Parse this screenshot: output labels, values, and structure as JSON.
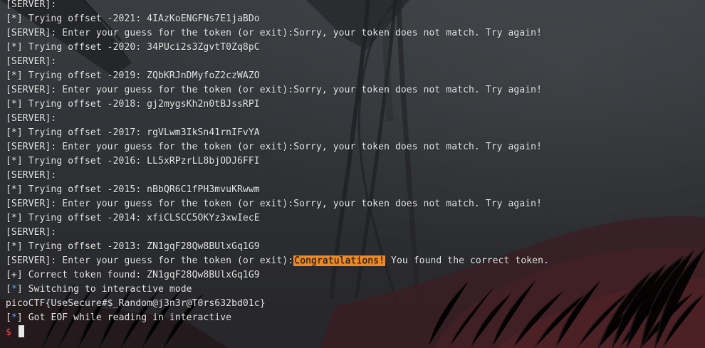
{
  "terminal": {
    "lines": [
      {
        "type": "plain",
        "text": "[SERVER]:"
      },
      {
        "type": "plain",
        "text": "[*] Trying offset -2021: 4IAzKoENGFNs7E1jaBDo"
      },
      {
        "type": "plain",
        "text": "[SERVER]: Enter your guess for the token (or exit):Sorry, your token does not match. Try again!"
      },
      {
        "type": "plain",
        "text": "[*] Trying offset -2020: 34PUci2s3ZgvtT0Zq8pC"
      },
      {
        "type": "plain",
        "text": "[SERVER]:"
      },
      {
        "type": "plain",
        "text": "[*] Trying offset -2019: ZQbKRJnDMyfoZ2czWAZO"
      },
      {
        "type": "plain",
        "text": "[SERVER]: Enter your guess for the token (or exit):Sorry, your token does not match. Try again!"
      },
      {
        "type": "plain",
        "text": "[*] Trying offset -2018: gj2mygsKh2n0tBJssRPI"
      },
      {
        "type": "plain",
        "text": "[SERVER]:"
      },
      {
        "type": "plain",
        "text": "[*] Trying offset -2017: rgVLwm3IkSn41rnIFvYA"
      },
      {
        "type": "plain",
        "text": "[SERVER]: Enter your guess for the token (or exit):Sorry, your token does not match. Try again!"
      },
      {
        "type": "plain",
        "text": "[*] Trying offset -2016: LL5xRPzrLL8bjODJ6FFI"
      },
      {
        "type": "plain",
        "text": "[SERVER]:"
      },
      {
        "type": "plain",
        "text": "[*] Trying offset -2015: nBbQR6C1fPH3mvuKRwwm"
      },
      {
        "type": "plain",
        "text": "[SERVER]: Enter your guess for the token (or exit):Sorry, your token does not match. Try again!"
      },
      {
        "type": "plain",
        "text": "[*] Trying offset -2014: xfiCLSCC5OKYz3xwIecE"
      },
      {
        "type": "plain",
        "text": "[SERVER]:"
      },
      {
        "type": "plain",
        "text": "[*] Trying offset -2013: ZN1gqF28Qw8BUlxGq1G9"
      },
      {
        "type": "highlight",
        "before": "[SERVER]: Enter your guess for the token (or exit):",
        "highlight": "Congratulations!",
        "after": " You found the correct token."
      },
      {
        "type": "plain",
        "text": "[+] Correct token found: ZN1gqF28Qw8BUlxGq1G9"
      },
      {
        "type": "status",
        "open": "[",
        "marker": "*",
        "close": "]",
        "text": " Switching to interactive mode"
      },
      {
        "type": "plain",
        "text": "picoCTF{UseSecure#$_Random@j3n3r@T0rs632bd01c}"
      },
      {
        "type": "status",
        "open": "[",
        "marker": "*",
        "close": "]",
        "text": " Got EOF while reading in interactive"
      },
      {
        "type": "prompt",
        "symbol": "$"
      }
    ],
    "colors": {
      "text": "#e6e6e6",
      "status_marker": "#6aa7ff",
      "highlight_bg": "#f08a24",
      "highlight_text": "#1a1a1a",
      "prompt_symbol": "#ff5555",
      "cursor": "#e8e8e8"
    }
  }
}
